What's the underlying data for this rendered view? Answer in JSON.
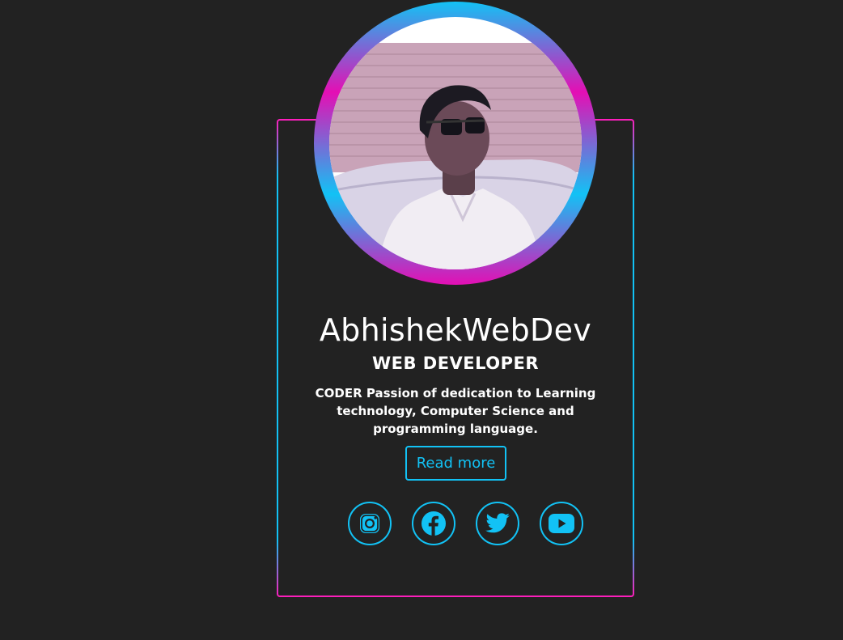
{
  "profile": {
    "name": "AbhishekWebDev",
    "role": "WEB DEVELOPER",
    "bio": "CODER Passion of dedication to Learning technology, Computer Science and programming language.",
    "read_more_label": "Read more"
  },
  "socials": [
    {
      "icon": "instagram-icon"
    },
    {
      "icon": "facebook-icon"
    },
    {
      "icon": "twitter-icon"
    },
    {
      "icon": "youtube-icon"
    }
  ],
  "colors": {
    "background": "#222222",
    "accent_cyan": "#12c2f5",
    "accent_pink": "#e40fb4",
    "text": "#ffffff"
  }
}
